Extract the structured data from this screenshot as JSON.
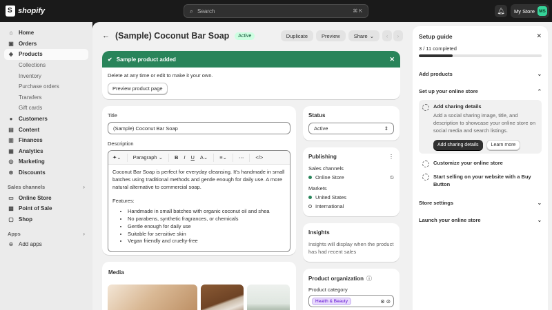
{
  "topbar": {
    "brand": "shopify",
    "search_placeholder": "Search",
    "search_shortcut": "⌘ K",
    "store_name": "My Store",
    "avatar_initials": "MS"
  },
  "sidebar": {
    "items": [
      {
        "label": "Home",
        "icon": "⌂"
      },
      {
        "label": "Orders",
        "icon": "▣"
      },
      {
        "label": "Products",
        "icon": "◈"
      },
      {
        "label": "Collections"
      },
      {
        "label": "Inventory"
      },
      {
        "label": "Purchase orders"
      },
      {
        "label": "Transfers"
      },
      {
        "label": "Gift cards"
      },
      {
        "label": "Customers",
        "icon": "●"
      },
      {
        "label": "Content",
        "icon": "▤"
      },
      {
        "label": "Finances",
        "icon": "▥"
      },
      {
        "label": "Analytics",
        "icon": "▦"
      },
      {
        "label": "Marketing",
        "icon": "◎"
      },
      {
        "label": "Discounts",
        "icon": "⊛"
      }
    ],
    "sales_channels_label": "Sales channels",
    "channels": [
      {
        "label": "Online Store",
        "icon": "▭"
      },
      {
        "label": "Point of Sale",
        "icon": "▩"
      },
      {
        "label": "Shop",
        "icon": "▢"
      }
    ],
    "apps_label": "Apps",
    "add_apps_label": "Add apps"
  },
  "header": {
    "title": "(Sample) Coconut Bar Soap",
    "status_badge": "Active",
    "duplicate_label": "Duplicate",
    "preview_label": "Preview",
    "share_label": "Share"
  },
  "banner": {
    "title": "Sample product added",
    "message": "Delete at any time or edit to make it your own.",
    "preview_button": "Preview product page"
  },
  "product": {
    "title_label": "Title",
    "title_value": "(Sample) Coconut Bar Soap",
    "description_label": "Description",
    "paragraph_label": "Paragraph",
    "description_intro": "Coconut Bar Soap is perfect for everyday cleansing. It's handmade in small batches using traditional methods and gentle enough for daily use. A more natural alternative to commercial soap.",
    "features_label": "Features:",
    "features": [
      "Handmade in small batches with organic coconut oil and shea",
      "No parabens, synthetic fragrances, or chemicals",
      "Gentle enough for daily use",
      "Suitable for sensitive skin",
      "Vegan friendly and cruelty-free"
    ],
    "media_label": "Media"
  },
  "status": {
    "label": "Status",
    "value": "Active"
  },
  "publishing": {
    "title": "Publishing",
    "sales_channels_label": "Sales channels",
    "channel": "Online Store",
    "markets_label": "Markets",
    "markets": [
      {
        "name": "United States",
        "active": true
      },
      {
        "name": "International",
        "active": false
      }
    ]
  },
  "insights": {
    "title": "Insights",
    "message": "Insights will display when the product has had recent sales"
  },
  "organization": {
    "title": "Product organization",
    "category_label": "Product category",
    "category_value": "Health & Beauty"
  },
  "guide": {
    "title": "Setup guide",
    "progress_text": "3 / 11 completed",
    "progress_fraction": 0.273,
    "sections": {
      "add_products": "Add products",
      "online_store": "Set up your online store",
      "store_settings": "Store settings",
      "launch": "Launch your online store"
    },
    "tasks": {
      "sharing_title": "Add sharing details",
      "sharing_desc": "Add a social sharing image, title, and description to showcase your online store on social media and search listings.",
      "sharing_primary": "Add sharing details",
      "sharing_secondary": "Learn more",
      "customize": "Customize your online store",
      "buy_button": "Start selling on your website with a Buy Button"
    }
  }
}
